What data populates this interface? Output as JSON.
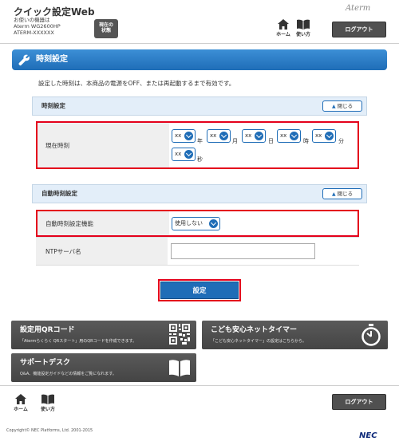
{
  "header": {
    "app_title": "クイック設定Web",
    "device_label": "お使いの機器は",
    "device_model": "Aterm WG2600HP",
    "device_id": "ATERM-XXXXXX",
    "status_button_line1": "現在の",
    "status_button_line2": "状態",
    "brand": "Aterm",
    "home_label": "ホーム",
    "help_label": "使い方",
    "logout_label": "ログアウト"
  },
  "page": {
    "title": "時刻設定",
    "notice": "設定した時刻は、本商品の電源をOFF、または再起動するまで有効です。"
  },
  "section_time": {
    "heading": "時刻設定",
    "collapse_label": "閉じる",
    "current_time_label": "現在時刻",
    "fields": [
      {
        "value": "xx",
        "unit": "年"
      },
      {
        "value": "xx",
        "unit": "月"
      },
      {
        "value": "xx",
        "unit": "日"
      },
      {
        "value": "xx",
        "unit": "時"
      },
      {
        "value": "xx",
        "unit": "分"
      },
      {
        "value": "xx",
        "unit": "秒"
      }
    ]
  },
  "section_auto": {
    "heading": "自動時刻設定",
    "collapse_label": "閉じる",
    "auto_label": "自動時刻設定機能",
    "auto_value": "使用しない",
    "ntp_label": "NTPサーバ名",
    "ntp_value": ""
  },
  "submit_label": "設定",
  "tiles": {
    "qr_title": "設定用QRコード",
    "qr_desc": "「Atermらくらく QRスタート」用のQRコードを作成できます。",
    "timer_title": "こども安心ネットタイマー",
    "timer_desc": "「こども安心ネットタイマー」の設定はこちらから。",
    "support_title": "サポートデスク",
    "support_desc": "Q&A、機能設定ガイドなどの情報をご覧になれます。"
  },
  "footer": {
    "home_label": "ホーム",
    "help_label": "使い方",
    "logout_label": "ログアウト",
    "copyright": "Copyright© NEC Platforms, Ltd. 2001-2015",
    "logo": "NEC"
  },
  "colors": {
    "accent_blue": "#1f6db7",
    "highlight_red": "#e4001b",
    "tile_gray": "#505050"
  }
}
